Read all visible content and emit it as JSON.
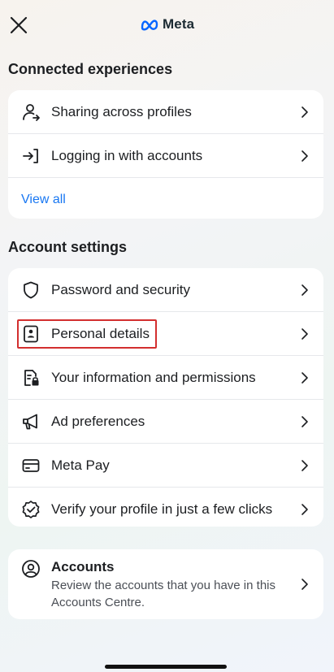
{
  "header": {
    "brand": "Meta"
  },
  "connected": {
    "title": "Connected experiences",
    "items": [
      {
        "label": "Sharing across profiles"
      },
      {
        "label": "Logging in with accounts"
      }
    ],
    "view_all": "View all"
  },
  "account_settings": {
    "title": "Account settings",
    "items": [
      {
        "label": "Password and security"
      },
      {
        "label": "Personal details"
      },
      {
        "label": "Your information and permissions"
      },
      {
        "label": "Ad preferences"
      },
      {
        "label": "Meta Pay"
      },
      {
        "label": "Verify your profile in just a few clicks"
      }
    ]
  },
  "accounts": {
    "title": "Accounts",
    "description": "Review the accounts that you have in this Accounts Centre."
  },
  "colors": {
    "link": "#1877f2",
    "highlight": "#d32f2f"
  }
}
